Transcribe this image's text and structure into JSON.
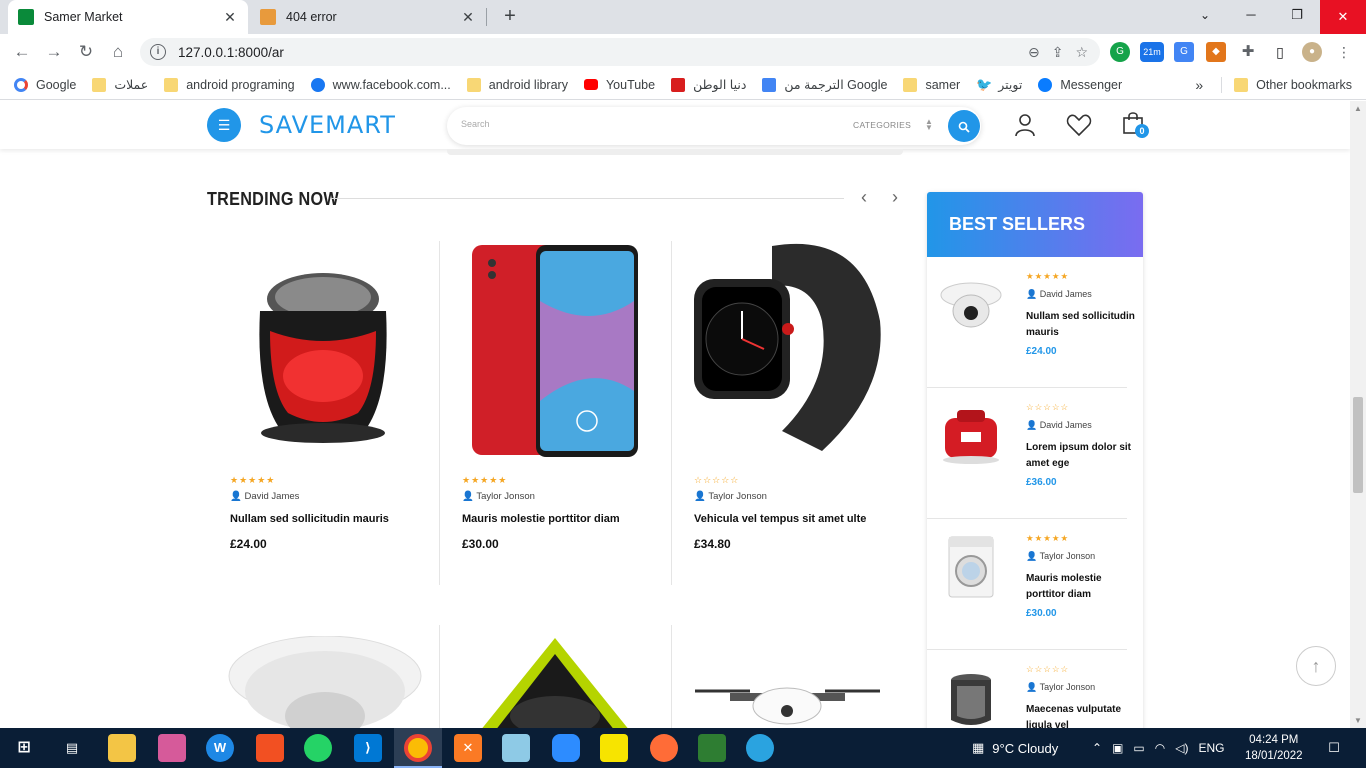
{
  "browser": {
    "tabs": [
      {
        "title": "Samer Market",
        "active": true
      },
      {
        "title": "404 error",
        "active": false
      }
    ],
    "new_tab": "+",
    "window_controls": {
      "minimize": "─",
      "restore": "❐",
      "close": "✕"
    },
    "address": "127.0.0.1:8000/ar",
    "extension_badge": "21m",
    "bookmarks": [
      {
        "label": "Google",
        "icon": "google-icon"
      },
      {
        "label": "عملات",
        "icon": "folder-icon"
      },
      {
        "label": "android programing",
        "icon": "folder-icon"
      },
      {
        "label": "www.facebook.com...",
        "icon": "facebook-icon"
      },
      {
        "label": "android library",
        "icon": "folder-icon"
      },
      {
        "label": "YouTube",
        "icon": "youtube-icon"
      },
      {
        "label": "دنيا الوطن",
        "icon": "news-icon"
      },
      {
        "label": "الترجمة من Google",
        "icon": "translate-icon"
      },
      {
        "label": "samer",
        "icon": "folder-icon"
      },
      {
        "label": "تويتر",
        "icon": "twitter-icon"
      },
      {
        "label": "Messenger",
        "icon": "messenger-icon"
      }
    ],
    "bookmarks_overflow": "»",
    "other_bookmarks": "Other bookmarks"
  },
  "site": {
    "logo": "SAVEMART",
    "search_placeholder": "Search",
    "categories_label": "CATEGORIES",
    "cart_count": "0",
    "accent": "#2196e8"
  },
  "trending": {
    "title": "TRENDING NOW",
    "products": [
      {
        "author": "David James",
        "name": "Nullam sed sollicitudin mauris",
        "price": "£24.00",
        "rating": 5
      },
      {
        "author": "Taylor Jonson",
        "name": "Mauris molestie porttitor diam",
        "price": "£30.00",
        "rating": 5
      },
      {
        "author": "Taylor Jonson",
        "name": "Vehicula vel tempus sit amet ulte",
        "price": "£34.80",
        "rating": 0
      }
    ]
  },
  "best_sellers": {
    "title": "BEST SELLERS",
    "items": [
      {
        "author": "David James",
        "name": "Nullam sed sollicitudin mauris",
        "price": "£24.00",
        "rating": 5
      },
      {
        "author": "David James",
        "name": "Lorem ipsum dolor sit amet ege",
        "price": "£36.00",
        "rating": 0
      },
      {
        "author": "Taylor Jonson",
        "name": "Mauris molestie porttitor diam",
        "price": "£30.00",
        "rating": 5
      },
      {
        "author": "Taylor Jonson",
        "name": "Maecenas vulputate ligula vel",
        "price": "",
        "rating": 0
      }
    ]
  },
  "taskbar": {
    "weather": "9°C  Cloudy",
    "language": "ENG",
    "time": "04:24 PM",
    "date": "18/01/2022"
  }
}
